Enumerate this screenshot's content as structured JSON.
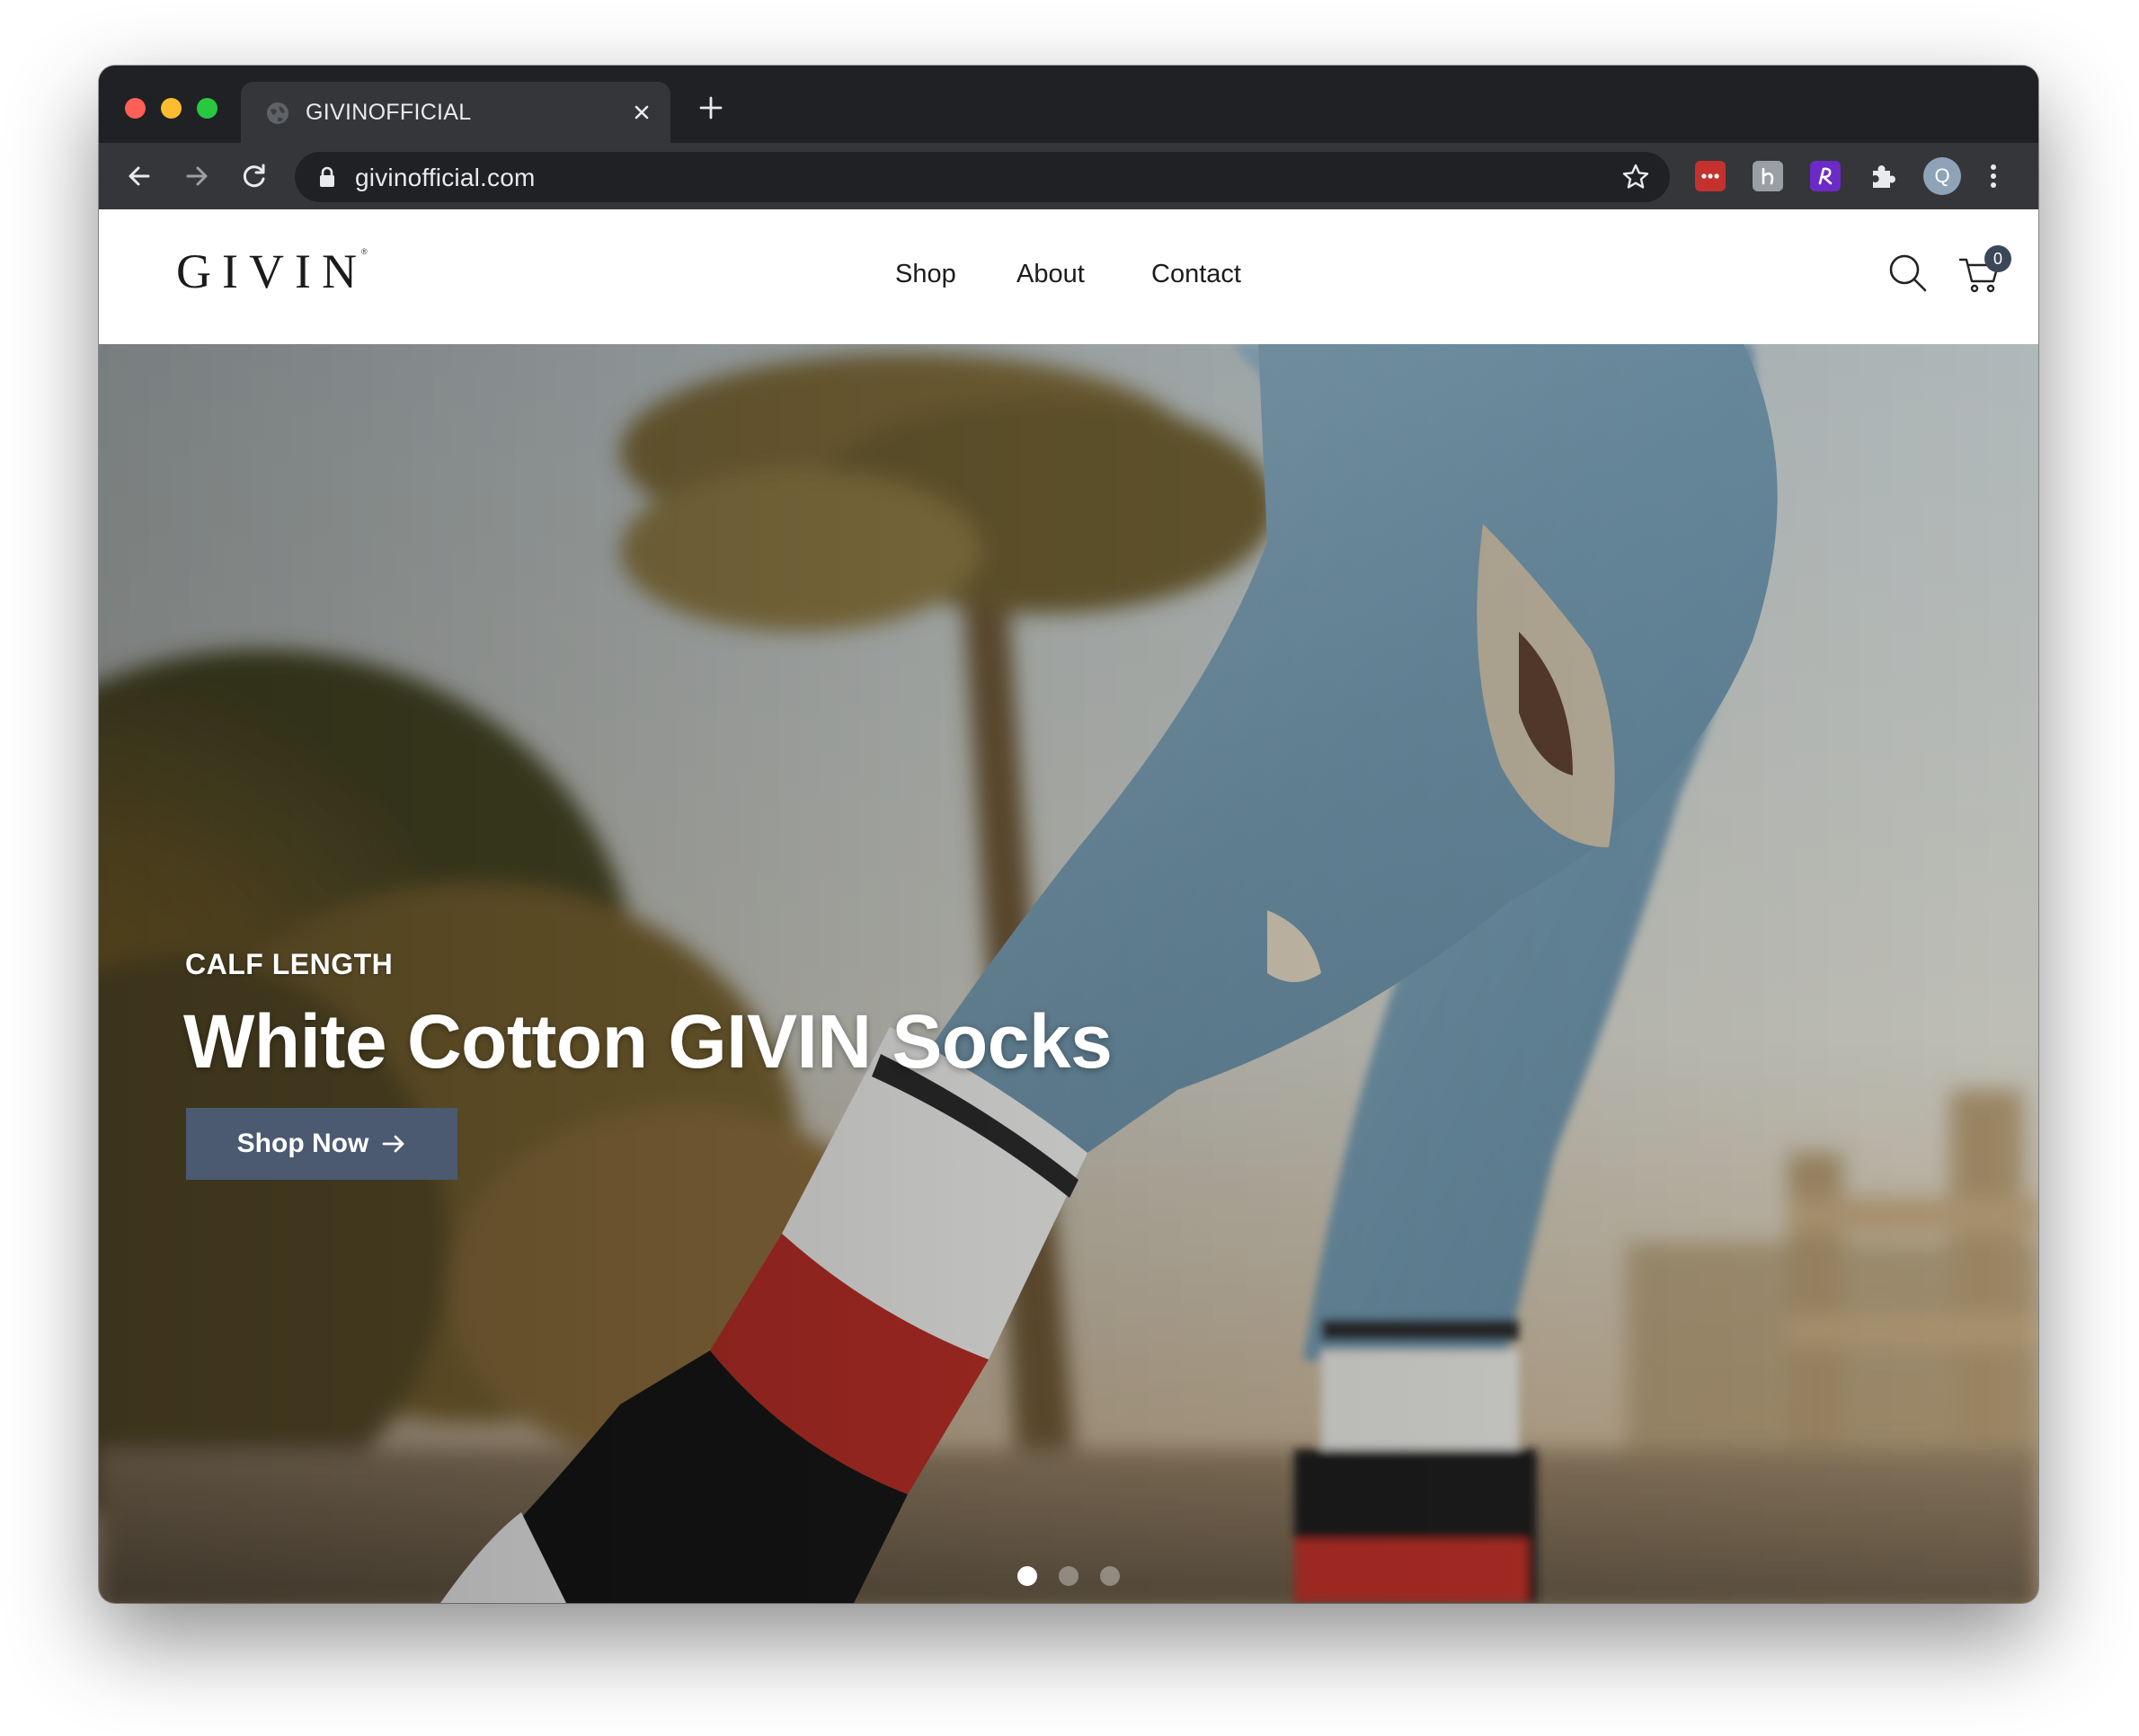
{
  "browser": {
    "tab_title": "GIVINOFFICIAL",
    "url": "givinofficial.com",
    "profile_initial": "Q"
  },
  "site": {
    "logo": "GIVIN",
    "nav": {
      "shop": "Shop",
      "about": "About",
      "contact": "Contact"
    },
    "cart_count": "0"
  },
  "hero": {
    "eyebrow": "CALF LENGTH",
    "title": "White Cotton GIVIN Socks",
    "cta_label": "Shop Now",
    "slides_total": 3,
    "active_slide": 1
  },
  "colors": {
    "cta_background": "#4b5a70",
    "cart_badge": "#3c4858",
    "browser_chrome": "#202124"
  }
}
